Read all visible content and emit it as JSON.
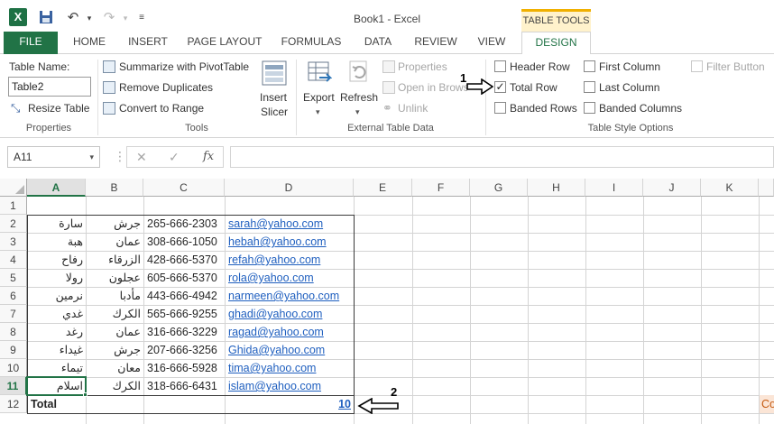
{
  "window": {
    "title": "Book1 - Excel",
    "contextual_group": "TABLE TOOLS"
  },
  "tabs": [
    "FILE",
    "HOME",
    "INSERT",
    "PAGE LAYOUT",
    "FORMULAS",
    "DATA",
    "REVIEW",
    "VIEW",
    "DESIGN"
  ],
  "ribbon": {
    "properties": {
      "table_name_label": "Table Name:",
      "table_name_value": "Table2",
      "resize_table": "Resize Table",
      "group_label": "Properties"
    },
    "tools": {
      "summarize": "Summarize with PivotTable",
      "remove_duplicates": "Remove Duplicates",
      "convert": "Convert to Range",
      "insert_slicer_1": "Insert",
      "insert_slicer_2": "Slicer",
      "group_label": "Tools"
    },
    "external": {
      "export": "Export",
      "refresh": "Refresh",
      "properties": "Properties",
      "open_in_browser": "Open in Browser",
      "unlink": "Unlink",
      "group_label": "External Table Data"
    },
    "style_options": {
      "header_row": "Header Row",
      "total_row": "Total Row",
      "banded_rows": "Banded Rows",
      "first_column": "First Column",
      "last_column": "Last Column",
      "banded_columns": "Banded Columns",
      "filter_button": "Filter Button",
      "group_label": "Table Style Options",
      "header_row_checked": false,
      "total_row_checked": true,
      "banded_rows_checked": false,
      "first_column_checked": false,
      "last_column_checked": false,
      "banded_columns_checked": false,
      "filter_button_checked": false
    }
  },
  "formula_bar": {
    "name_box": "A11",
    "fx": "fx",
    "value": ""
  },
  "columns": [
    "A",
    "B",
    "C",
    "D",
    "E",
    "F",
    "G",
    "H",
    "I",
    "J",
    "K"
  ],
  "rows": [
    {
      "num": "1",
      "a": "",
      "b": "",
      "c": "",
      "d": ""
    },
    {
      "num": "2",
      "a": "سارة",
      "b": "جرش",
      "c": "265-666-2303",
      "d": "sarah@yahoo.com"
    },
    {
      "num": "3",
      "a": "هبة",
      "b": "عمان",
      "c": "308-666-1050",
      "d": "hebah@yahoo.com"
    },
    {
      "num": "4",
      "a": "رفاح",
      "b": "الزرقاء",
      "c": "428-666-5370",
      "d": "refah@yahoo.com"
    },
    {
      "num": "5",
      "a": "رولا",
      "b": "عجلون",
      "c": "605-666-5370",
      "d": "rola@yahoo.com"
    },
    {
      "num": "6",
      "a": "نرمين",
      "b": "مأدبا",
      "c": "443-666-4942",
      "d": "narmeen@yahoo.com"
    },
    {
      "num": "7",
      "a": "غدي",
      "b": "الكرك",
      "c": "565-666-9255",
      "d": "ghadi@yahoo.com"
    },
    {
      "num": "8",
      "a": "رغد",
      "b": "عمان",
      "c": "316-666-3229",
      "d": "ragad@yahoo.com"
    },
    {
      "num": "9",
      "a": "غيداء",
      "b": "جرش",
      "c": "207-666-3256",
      "d": "Ghida@yahoo.com"
    },
    {
      "num": "10",
      "a": "تيماء",
      "b": "معان",
      "c": "316-666-5928",
      "d": "tima@yahoo.com"
    },
    {
      "num": "11",
      "a": "اسلام",
      "b": "الكرك",
      "c": "318-666-6431",
      "d": "islam@yahoo.com"
    },
    {
      "num": "12",
      "a": "Total",
      "b": "",
      "c": "",
      "d": "10"
    }
  ],
  "annotations": {
    "marker1": "1",
    "marker2": "2"
  },
  "partial_cell_text": "Co"
}
